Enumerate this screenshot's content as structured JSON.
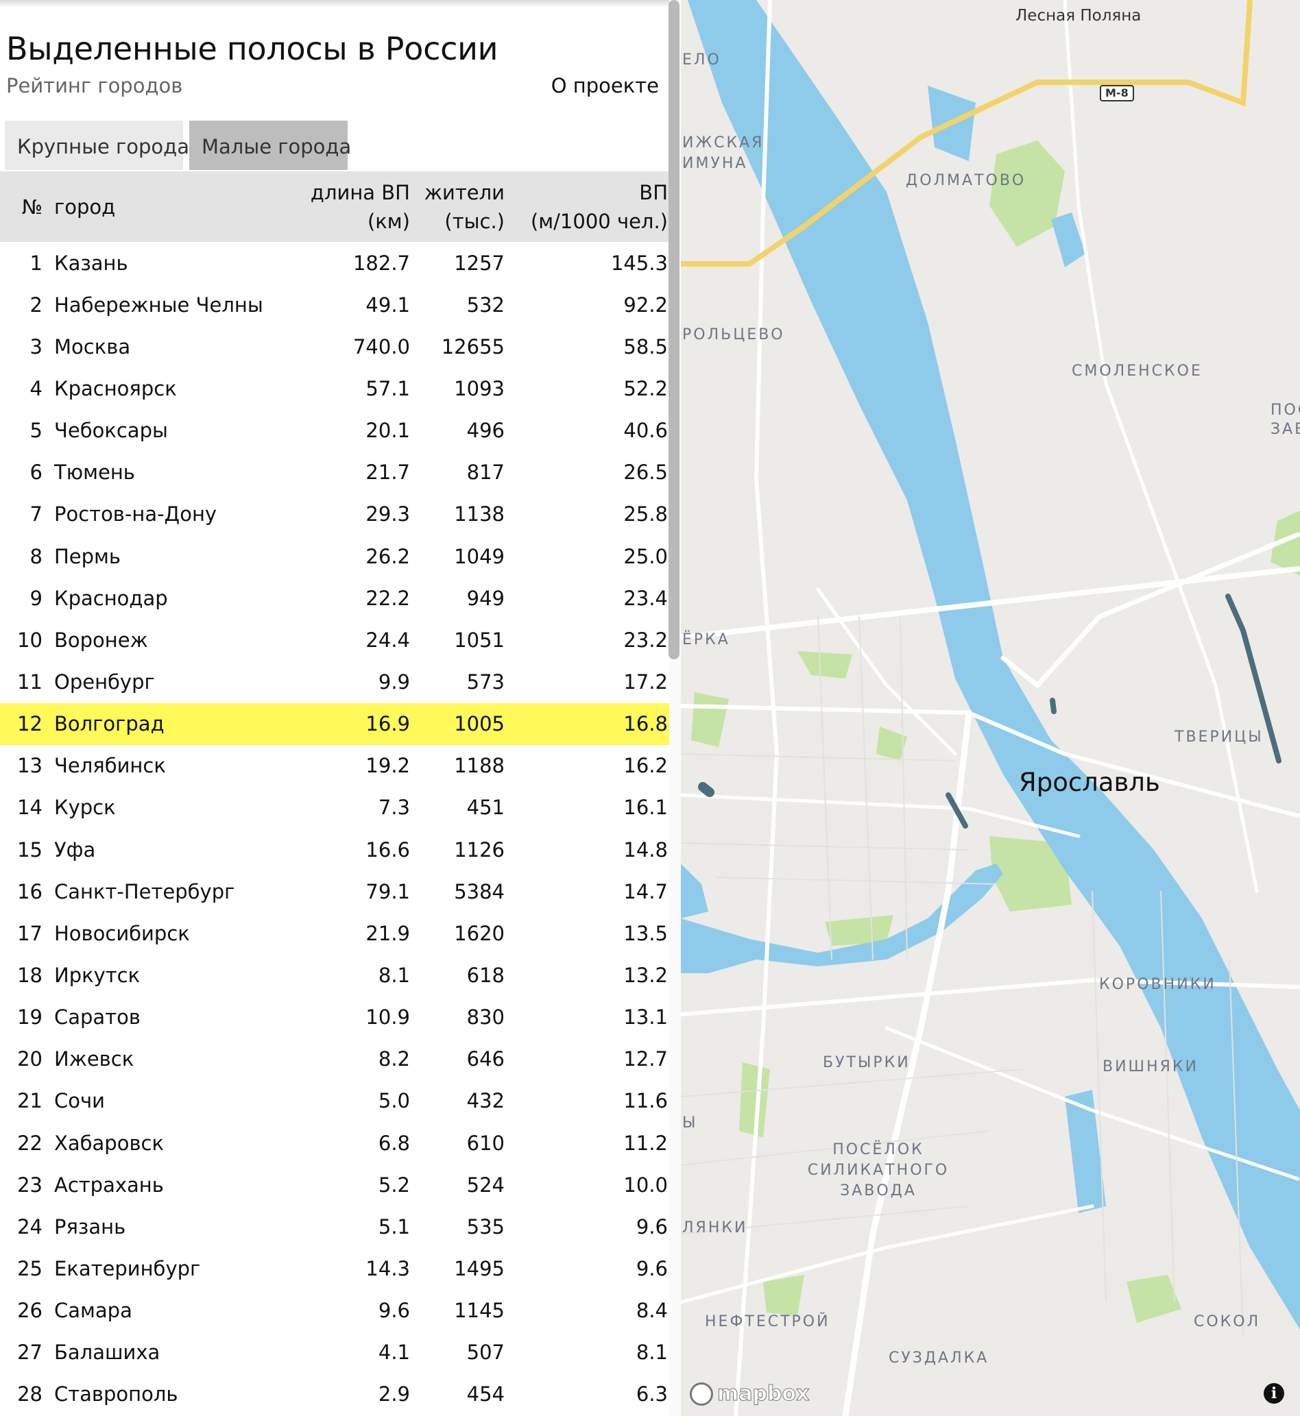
{
  "sidebar": {
    "title": "Выделенные полосы в России",
    "subtitle": "Рейтинг городов",
    "about_link": "О проекте",
    "tabs": [
      {
        "label": "Крупные города",
        "active": true
      },
      {
        "label": "Малые города",
        "active": false
      }
    ],
    "table": {
      "headers": {
        "num": "№",
        "city": "город",
        "length": [
          "длина ВП",
          "(км)"
        ],
        "population": [
          "жители",
          "(тыс.)"
        ],
        "vp": [
          "ВП",
          "(м/1000 чел.)"
        ]
      },
      "highlight_color": "#fff95a",
      "rows": [
        {
          "n": "1",
          "city": "Казань",
          "len": "182.7",
          "pop": "1257",
          "vp": "145.3"
        },
        {
          "n": "2",
          "city": "Набережные Челны",
          "len": "49.1",
          "pop": "532",
          "vp": "92.2"
        },
        {
          "n": "3",
          "city": "Москва",
          "len": "740.0",
          "pop": "12655",
          "vp": "58.5"
        },
        {
          "n": "4",
          "city": "Красноярск",
          "len": "57.1",
          "pop": "1093",
          "vp": "52.2"
        },
        {
          "n": "5",
          "city": "Чебоксары",
          "len": "20.1",
          "pop": "496",
          "vp": "40.6"
        },
        {
          "n": "6",
          "city": "Тюмень",
          "len": "21.7",
          "pop": "817",
          "vp": "26.5"
        },
        {
          "n": "7",
          "city": "Ростов-на-Дону",
          "len": "29.3",
          "pop": "1138",
          "vp": "25.8"
        },
        {
          "n": "8",
          "city": "Пермь",
          "len": "26.2",
          "pop": "1049",
          "vp": "25.0"
        },
        {
          "n": "9",
          "city": "Краснодар",
          "len": "22.2",
          "pop": "949",
          "vp": "23.4"
        },
        {
          "n": "10",
          "city": "Воронеж",
          "len": "24.4",
          "pop": "1051",
          "vp": "23.2"
        },
        {
          "n": "11",
          "city": "Оренбург",
          "len": "9.9",
          "pop": "573",
          "vp": "17.2"
        },
        {
          "n": "12",
          "city": "Волгоград",
          "len": "16.9",
          "pop": "1005",
          "vp": "16.8",
          "highlighted": true
        },
        {
          "n": "13",
          "city": "Челябинск",
          "len": "19.2",
          "pop": "1188",
          "vp": "16.2"
        },
        {
          "n": "14",
          "city": "Курск",
          "len": "7.3",
          "pop": "451",
          "vp": "16.1"
        },
        {
          "n": "15",
          "city": "Уфа",
          "len": "16.6",
          "pop": "1126",
          "vp": "14.8"
        },
        {
          "n": "16",
          "city": "Санкт-Петербург",
          "len": "79.1",
          "pop": "5384",
          "vp": "14.7"
        },
        {
          "n": "17",
          "city": "Новосибирск",
          "len": "21.9",
          "pop": "1620",
          "vp": "13.5"
        },
        {
          "n": "18",
          "city": "Иркутск",
          "len": "8.1",
          "pop": "618",
          "vp": "13.2"
        },
        {
          "n": "19",
          "city": "Саратов",
          "len": "10.9",
          "pop": "830",
          "vp": "13.1"
        },
        {
          "n": "20",
          "city": "Ижевск",
          "len": "8.2",
          "pop": "646",
          "vp": "12.7"
        },
        {
          "n": "21",
          "city": "Сочи",
          "len": "5.0",
          "pop": "432",
          "vp": "11.6"
        },
        {
          "n": "22",
          "city": "Хабаровск",
          "len": "6.8",
          "pop": "610",
          "vp": "11.2"
        },
        {
          "n": "23",
          "city": "Астрахань",
          "len": "5.2",
          "pop": "524",
          "vp": "10.0"
        },
        {
          "n": "24",
          "city": "Рязань",
          "len": "5.1",
          "pop": "535",
          "vp": "9.6"
        },
        {
          "n": "25",
          "city": "Екатеринбург",
          "len": "14.3",
          "pop": "1495",
          "vp": "9.6"
        },
        {
          "n": "26",
          "city": "Самара",
          "len": "9.6",
          "pop": "1145",
          "vp": "8.4"
        },
        {
          "n": "27",
          "city": "Балашиха",
          "len": "4.1",
          "pop": "507",
          "vp": "8.1"
        },
        {
          "n": "28",
          "city": "Ставрополь",
          "len": "2.9",
          "pop": "454",
          "vp": "6.3"
        }
      ]
    }
  },
  "map": {
    "city_label": "Ярославль",
    "place_label": "Лесная Поляна",
    "road_shield": "М-8",
    "districts": [
      "ДОЛМАТОВО",
      "СМОЛЕНСКОЕ",
      "ТВЕРИЦЫ",
      "КОРОВНИКИ",
      "ВИШНЯКИ",
      "БУТЫРКИ",
      "ПОСЁЛОК СИЛИКАТНОГО ЗАВОДА",
      "НЕФТЕСТРОЙ",
      "СУЗДАЛКА",
      "СОКОЛ"
    ],
    "partial_labels": [
      "ЕЛО",
      "ИЖСКАЯ",
      "ИМУНА",
      "РОЛЬЦЕВО",
      "ПОС",
      "ЗАВ",
      "ЁРКА",
      "Ы",
      "ЛЯНКИ"
    ],
    "attribution": "mapbox",
    "info_icon": "i",
    "colors": {
      "land": "#ecebe7",
      "water": "#8ecbea",
      "park": "#c5e3a4",
      "road": "#ffffff",
      "highway": "#f2d36b",
      "bus_lane": "#4a6e7d"
    }
  }
}
